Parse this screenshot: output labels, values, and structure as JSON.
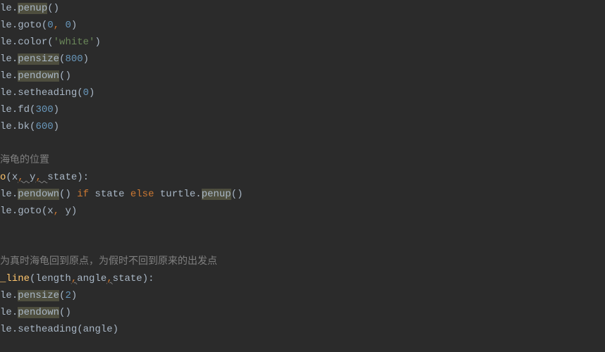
{
  "code": {
    "lines": [
      {
        "type": "call",
        "obj": "le",
        "method": "penup",
        "hl": true,
        "args": ""
      },
      {
        "type": "call",
        "obj": "le",
        "method": "goto",
        "hl": false,
        "args_parts": [
          {
            "t": "num",
            "v": "0"
          },
          {
            "t": "comma",
            "v": ", "
          },
          {
            "t": "num",
            "v": "0"
          }
        ]
      },
      {
        "type": "call",
        "obj": "le",
        "method": "color",
        "hl": false,
        "args_parts": [
          {
            "t": "str",
            "v": "'white'"
          }
        ]
      },
      {
        "type": "call",
        "obj": "le",
        "method": "pensize",
        "hl": true,
        "args_parts": [
          {
            "t": "num",
            "v": "800"
          }
        ]
      },
      {
        "type": "call",
        "obj": "le",
        "method": "pendown",
        "hl": true,
        "args": ""
      },
      {
        "type": "call",
        "obj": "le",
        "method": "setheading",
        "hl": false,
        "args_parts": [
          {
            "t": "num",
            "v": "0"
          }
        ]
      },
      {
        "type": "call",
        "obj": "le",
        "method": "fd",
        "hl": false,
        "args_parts": [
          {
            "t": "num",
            "v": "300"
          }
        ]
      },
      {
        "type": "call",
        "obj": "le",
        "method": "bk",
        "hl": false,
        "args_parts": [
          {
            "t": "num",
            "v": "600"
          }
        ]
      },
      {
        "type": "blank"
      },
      {
        "type": "comment",
        "text": "海龟的位置"
      },
      {
        "type": "sig",
        "name": "o",
        "params": "x, y, state"
      },
      {
        "type": "cond",
        "obj1": "le",
        "method1": "pendown",
        "hl1": true,
        "kw1": "if",
        "var": "state",
        "kw2": "else",
        "obj2": "turtle",
        "method2": "penup",
        "hl2": true
      },
      {
        "type": "call",
        "obj": "le",
        "method": "goto",
        "hl": false,
        "args_parts": [
          {
            "t": "param",
            "v": "x"
          },
          {
            "t": "comma",
            "v": ", "
          },
          {
            "t": "param",
            "v": "y"
          }
        ]
      },
      {
        "type": "blank"
      },
      {
        "type": "blank"
      },
      {
        "type": "comment",
        "text": "为真时海龟回到原点，为假时不回到原来的出发点"
      },
      {
        "type": "def",
        "name": "_line",
        "params_raw": "length,angle,state"
      },
      {
        "type": "call",
        "obj": "le",
        "method": "pensize",
        "hl": true,
        "args_parts": [
          {
            "t": "num",
            "v": "2"
          }
        ]
      },
      {
        "type": "call",
        "obj": "le",
        "method": "pendown",
        "hl": true,
        "args": ""
      },
      {
        "type": "call",
        "obj": "le",
        "method": "setheading",
        "hl": false,
        "args_parts": [
          {
            "t": "param",
            "v": "angle"
          }
        ]
      }
    ]
  }
}
